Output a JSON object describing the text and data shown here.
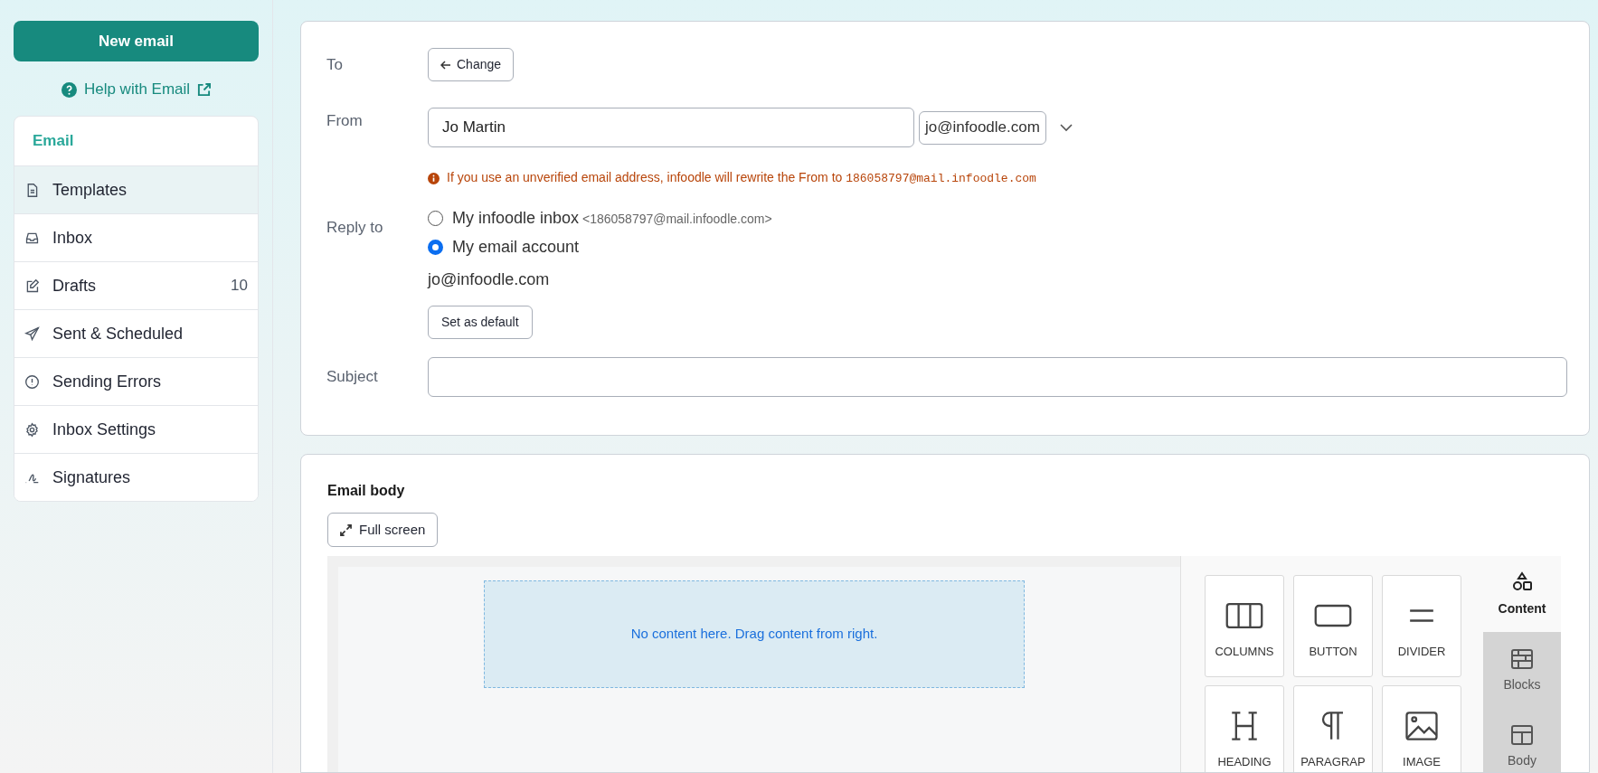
{
  "sidebar": {
    "new_email_button": "New email",
    "help_link": "Help with Email",
    "nav_heading": "Email",
    "items": [
      {
        "kind": "document",
        "label": "Templates",
        "selected": true
      },
      {
        "kind": "inbox",
        "label": "Inbox",
        "selected": false
      },
      {
        "kind": "pencil",
        "label": "Drafts",
        "selected": false,
        "count": "10"
      },
      {
        "kind": "send",
        "label": "Sent & Scheduled",
        "selected": false
      },
      {
        "kind": "alert",
        "label": "Sending Errors",
        "selected": false
      },
      {
        "kind": "gear",
        "label": "Inbox Settings",
        "selected": false
      },
      {
        "kind": "signature",
        "label": "Signatures",
        "selected": false
      }
    ]
  },
  "form": {
    "to": {
      "label": "To",
      "button": "Change"
    },
    "from": {
      "label": "From",
      "name_value": "Jo Martin",
      "email_value": "jo@infoodle.com"
    },
    "warning": {
      "text": "If you use an unverified email address, infoodle will rewrite the From to",
      "address": "186058797@mail.infoodle.com"
    },
    "reply_to": {
      "label": "Reply to",
      "options": [
        {
          "label": "My infoodle inbox",
          "detail": "<186058797@mail.infoodle.com>",
          "selected": false
        },
        {
          "label": "My email account",
          "selected": true
        }
      ],
      "address": "jo@infoodle.com",
      "default_button": "Set as default"
    },
    "subject": {
      "label": "Subject"
    }
  },
  "body": {
    "title": "Email body",
    "fullscreen_button": "Full screen",
    "drop_hint": "No content here. Drag content from right.",
    "tiles": [
      {
        "kind": "columns",
        "label": "COLUMNS"
      },
      {
        "kind": "button",
        "label": "BUTTON"
      },
      {
        "kind": "divider",
        "label": "DIVIDER"
      },
      {
        "kind": "heading",
        "label": "HEADING"
      },
      {
        "kind": "paragraph",
        "label": "PARAGRAP"
      },
      {
        "kind": "image",
        "label": "IMAGE"
      }
    ],
    "tabs": [
      {
        "kind": "content",
        "label": "Content",
        "selected": true
      },
      {
        "kind": "blocks",
        "label": "Blocks",
        "selected": false
      },
      {
        "kind": "body",
        "label": "Body",
        "selected": false
      }
    ]
  }
}
